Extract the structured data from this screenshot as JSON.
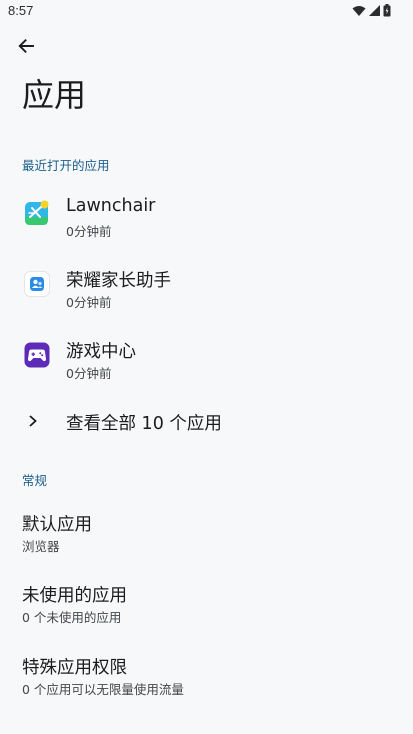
{
  "status_bar": {
    "time": "8:57",
    "icons": [
      "wifi-icon",
      "signal-icon",
      "battery-icon"
    ]
  },
  "header": {
    "back_icon": "arrow-back-icon",
    "title": "应用"
  },
  "recent": {
    "section_label": "最近打开的应用",
    "apps": [
      {
        "name": "Lawnchair",
        "time": "0分钟前",
        "icon": "lawnchair-icon"
      },
      {
        "name": "荣耀家长助手",
        "time": "0分钟前",
        "icon": "parent-assistant-icon"
      },
      {
        "name": "游戏中心",
        "time": "0分钟前",
        "icon": "game-center-icon"
      }
    ],
    "see_all_label": "查看全部 10 个应用"
  },
  "general": {
    "section_label": "常规",
    "items": [
      {
        "title": "默认应用",
        "subtitle": "浏览器"
      },
      {
        "title": "未使用的应用",
        "subtitle": "0 个未使用的应用"
      },
      {
        "title": "特殊应用权限",
        "subtitle": "0 个应用可以无限量使用流量"
      }
    ]
  },
  "colors": {
    "background": "#f6f8f9",
    "accent": "#1c5f8c"
  }
}
